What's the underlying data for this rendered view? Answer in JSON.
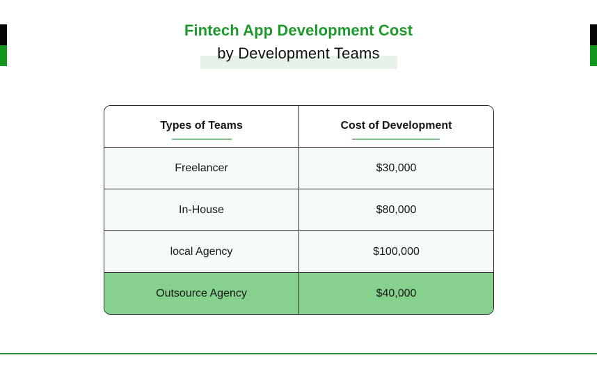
{
  "title": {
    "line1": "Fintech App Development Cost",
    "line2": "by Development Teams"
  },
  "colors": {
    "title_green": "#1e9a2c",
    "accent_green": "#12951d",
    "highlight_row": "#86d18d",
    "header_underline": "#7dbf86",
    "row_background": "#f6fcfc"
  },
  "table": {
    "headers": [
      "Types of Teams",
      "Cost of Development"
    ],
    "rows": [
      {
        "team": "Freelancer",
        "cost": "$30,000"
      },
      {
        "team": "In-House",
        "cost": "$80,000"
      },
      {
        "team": "local Agency",
        "cost": "$100,000"
      },
      {
        "team": "Outsource Agency",
        "cost": "$40,000"
      }
    ],
    "highlighted_row_index": 3
  }
}
